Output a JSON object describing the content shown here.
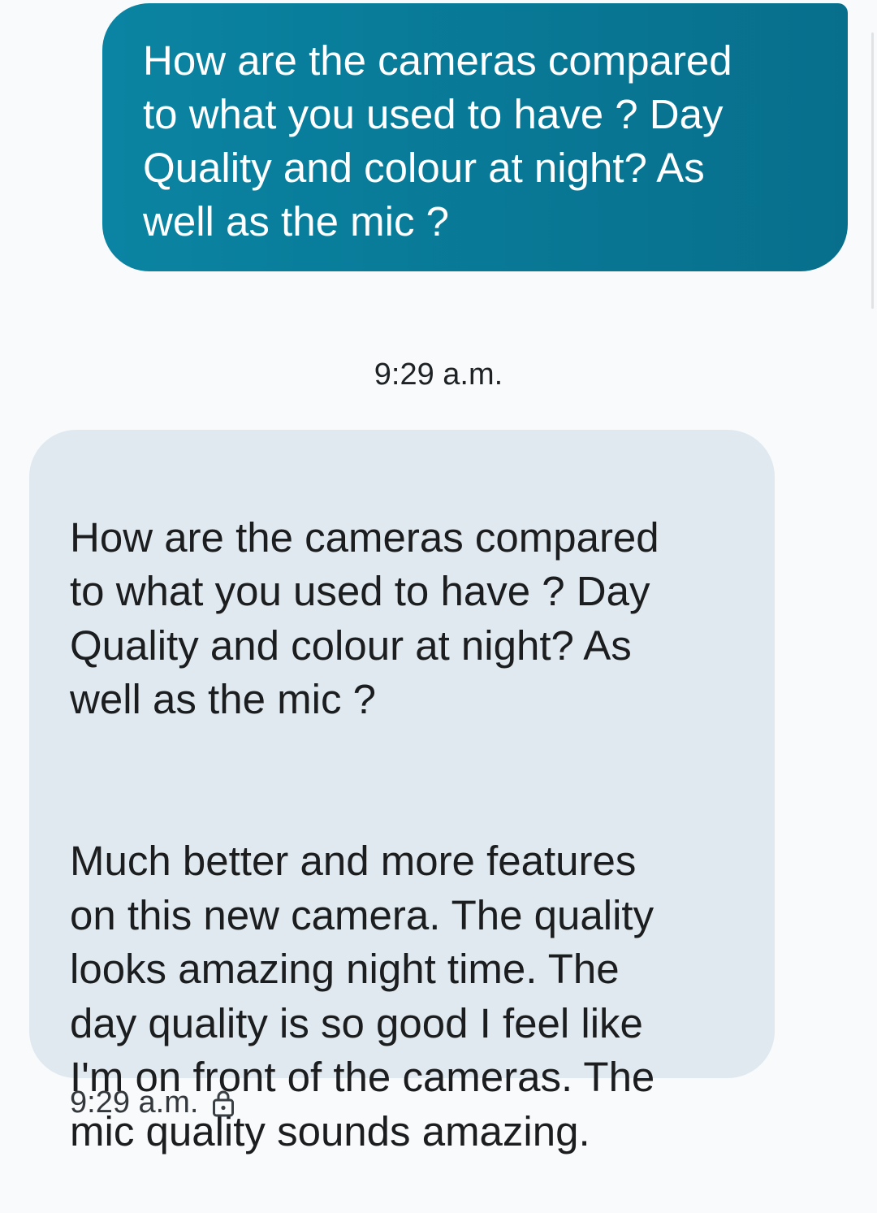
{
  "messages": {
    "outgoing": {
      "text": "How are the cameras compared\nto what you used to have ? Day\nQuality and colour at night? As\nwell as the mic ?"
    },
    "divider_time": "9:29 a.m.",
    "incoming": {
      "quoted_text": "How are the cameras compared\nto what you used to have ? Day\nQuality and colour at night? As\nwell as the mic ?",
      "reply_text": "Much better and more features\non this new camera. The quality\nlooks amazing night time.  The\nday quality is so good I feel like\nI'm on front of the cameras. The\nmic quality sounds amazing.",
      "time": "9:29 a.m.",
      "status_icon": "lock-icon"
    }
  },
  "colors": {
    "outgoing_bubble": "#0a84a2",
    "incoming_bubble": "#dfe9ef",
    "background": "#f8fafb"
  }
}
